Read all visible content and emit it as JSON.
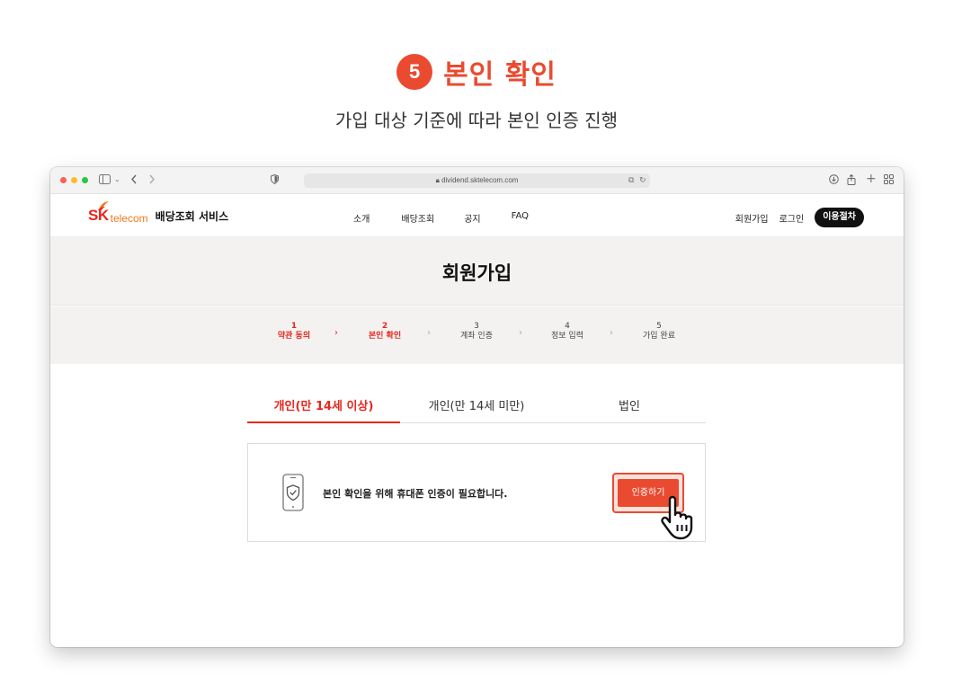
{
  "heading": {
    "step_number": "5",
    "step_title": "본인 확인",
    "subtitle": "가입 대상 기준에 따라 본인 인증 진행",
    "accent_color": "#ea4a2f"
  },
  "browser": {
    "url": "dividend.sktelecom.com",
    "icons": [
      "sidebar-icon",
      "chevron-down-icon",
      "back-icon",
      "forward-icon",
      "shield-icon",
      "lock-icon",
      "tab-icon",
      "reload-icon",
      "download-icon",
      "share-icon",
      "new-tab-icon",
      "grid-icon"
    ]
  },
  "site": {
    "logo_sk": "SK",
    "logo_telecom": "telecom",
    "service_name": "배당조회 서비스",
    "nav": [
      "소개",
      "배당조회",
      "공지",
      "FAQ"
    ],
    "signup_link": "회원가입",
    "login_link": "로그인",
    "guide_button": "이용절차"
  },
  "page": {
    "title": "회원가입",
    "steps": [
      {
        "num": "1",
        "label": "약관 동의",
        "active": true
      },
      {
        "num": "2",
        "label": "본인 확인",
        "active": true
      },
      {
        "num": "3",
        "label": "계좌 인증",
        "active": false
      },
      {
        "num": "4",
        "label": "정보 입력",
        "active": false
      },
      {
        "num": "5",
        "label": "가입 완료",
        "active": false
      }
    ],
    "tabs": [
      {
        "label": "개인(만 14세 이상)",
        "active": true
      },
      {
        "label": "개인(만 14세 미만)",
        "active": false
      },
      {
        "label": "법인",
        "active": false
      }
    ],
    "verify_message": "본인 확인을 위해 휴대폰 인증이 필요합니다.",
    "verify_button": "인증하기"
  }
}
